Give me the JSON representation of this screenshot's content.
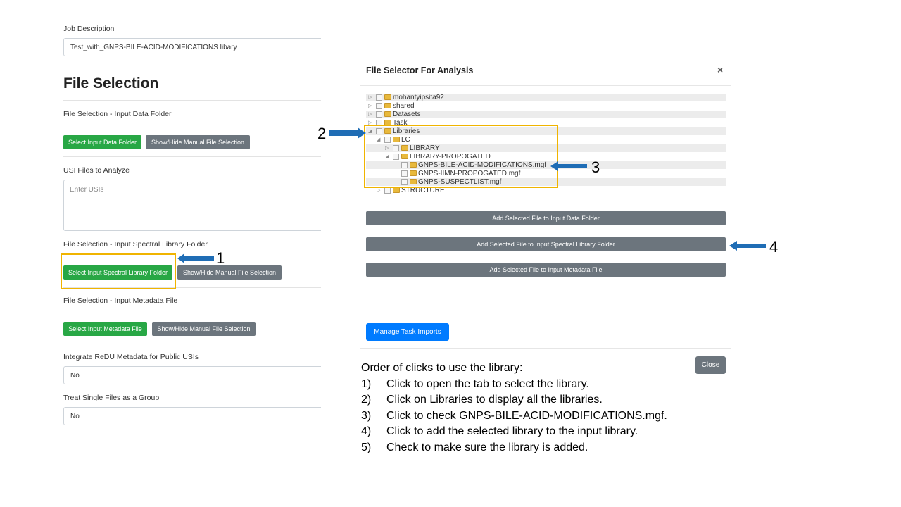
{
  "form": {
    "job_description_label": "Job Description",
    "job_description_value": "Test_with_GNPS-BILE-ACID-MODIFICATIONS libary",
    "section_title": "File Selection",
    "input_data_label": "File Selection - Input Data Folder",
    "select_input_data_btn": "Select Input Data Folder",
    "show_hide_btn": "Show/Hide Manual File Selection",
    "usi_label": "USI Files to Analyze",
    "usi_placeholder": "Enter USIs",
    "spectral_label": "File Selection - Input Spectral Library Folder",
    "select_spectral_btn": "Select Input Spectral Library Folder",
    "metadata_label": "File Selection - Input Metadata File",
    "select_metadata_btn": "Select Input Metadata File",
    "redu_label": "Integrate ReDU Metadata for Public USIs",
    "redu_value": "No",
    "group_label": "Treat Single Files as a Group",
    "group_value": "No"
  },
  "modal": {
    "title": "File Selector For Analysis",
    "close_x": "×",
    "tree": [
      {
        "label": "mohantyipsita92",
        "type": "folder",
        "expander": "▷"
      },
      {
        "label": "shared",
        "type": "folder",
        "expander": "▷"
      },
      {
        "label": "Datasets",
        "type": "folder",
        "expander": "▷"
      },
      {
        "label": "Task",
        "type": "folder",
        "expander": "▷"
      },
      {
        "label": "Libraries",
        "type": "folder",
        "expander": "◢"
      },
      {
        "label": "LC",
        "type": "folder",
        "expander": "◢"
      },
      {
        "label": "LIBRARY",
        "type": "folder",
        "expander": "▷"
      },
      {
        "label": "LIBRARY-PROPOGATED",
        "type": "folder",
        "expander": "◢"
      },
      {
        "label": "GNPS-BILE-ACID-MODIFICATIONS.mgf",
        "type": "file",
        "expander": ""
      },
      {
        "label": "GNPS-IIMN-PROPOGATED.mgf",
        "type": "file",
        "expander": ""
      },
      {
        "label": "GNPS-SUSPECTLIST.mgf",
        "type": "file",
        "expander": ""
      },
      {
        "label": "STRUCTURE",
        "type": "folder",
        "expander": "▷"
      }
    ],
    "add_data_btn": "Add Selected File to Input Data Folder",
    "add_spectral_btn": "Add Selected File to Input Spectral Library Folder",
    "add_metadata_btn": "Add Selected File to Input Metadata File",
    "manage_imports_btn": "Manage Task Imports",
    "close_btn": "Close"
  },
  "annotations": {
    "n1": "1",
    "n2": "2",
    "n3": "3",
    "n4": "4",
    "arrow_color": "#1f6db5",
    "highlight_color": "#f0b400"
  },
  "instructions": {
    "heading": "Order of clicks to use the library:",
    "steps": [
      {
        "n": "1)",
        "text": "Click to open the tab to select the library."
      },
      {
        "n": "2)",
        "text": "Click on Libraries to display all the libraries."
      },
      {
        "n": "3)",
        "text": "Click to check GNPS-BILE-ACID-MODIFICATIONS.mgf."
      },
      {
        "n": "4)",
        "text": "Click to add the selected library to the input library."
      },
      {
        "n": "5)",
        "text": "Check to make sure the library is added."
      }
    ]
  }
}
